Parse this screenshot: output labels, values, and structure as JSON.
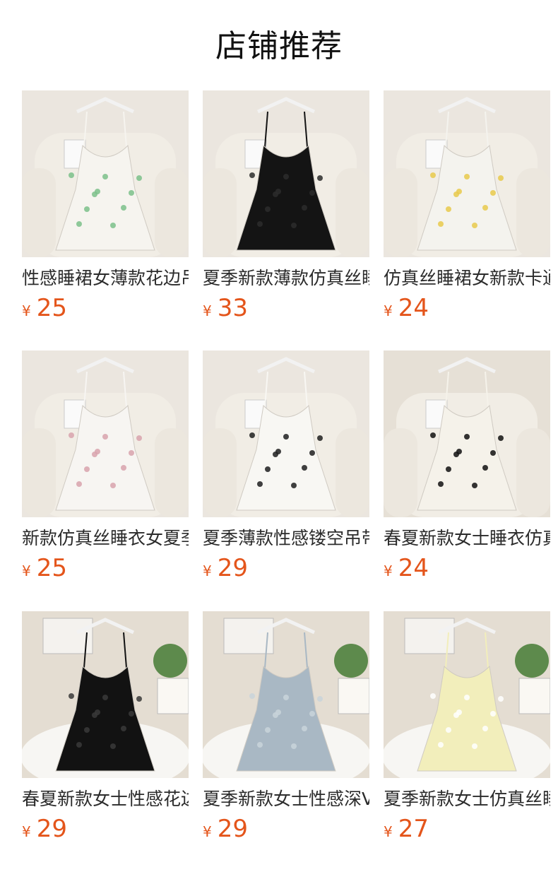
{
  "header": {
    "title": "店铺推荐"
  },
  "products": [
    {
      "name": "性感睡裙女薄款花边吊带",
      "currency": "¥",
      "price": "25",
      "image": "white floral slip dress on chair",
      "bg": "#ebe6df",
      "dress": "#f6f4ef",
      "accent": "#7bbf8a"
    },
    {
      "name": "夏季新款薄款仿真丝睡裙",
      "currency": "¥",
      "price": "33",
      "image": "black lace slip dress on chair",
      "bg": "#ebe6df",
      "dress": "#141414",
      "accent": "#2c2c2c"
    },
    {
      "name": "仿真丝睡裙女新款卡通吊带",
      "currency": "¥",
      "price": "24",
      "image": "white printed slip dress on chair",
      "bg": "#ebe6df",
      "dress": "#f4f3ee",
      "accent": "#e7c94b"
    },
    {
      "name": "新款仿真丝睡衣女夏季吊带",
      "currency": "¥",
      "price": "25",
      "image": "white slip dress with pink pattern",
      "bg": "#ebe6df",
      "dress": "#f7f5f2",
      "accent": "#d8a2ad"
    },
    {
      "name": "夏季薄款性感镂空吊带睡裙",
      "currency": "¥",
      "price": "29",
      "image": "white cherry print slip dress",
      "bg": "#ebe6df",
      "dress": "#f8f7f3",
      "accent": "#1e1e1e"
    },
    {
      "name": "春夏新款女士睡衣仿真丝",
      "currency": "¥",
      "price": "24",
      "image": "white heart print slip dress",
      "bg": "#e6e0d6",
      "dress": "#f5f2ea",
      "accent": "#111111"
    },
    {
      "name": "春夏新款女士性感花边睡裙",
      "currency": "¥",
      "price": "29",
      "image": "black lace slip dress on fur",
      "bg": "#e4ddd2",
      "dress": "#121212",
      "accent": "#3a3a3a"
    },
    {
      "name": "夏季新款女士性感深V睡裙",
      "currency": "¥",
      "price": "29",
      "image": "light blue lace slip dress on fur",
      "bg": "#e4ddd2",
      "dress": "#a9b8c4",
      "accent": "#c9d3db"
    },
    {
      "name": "夏季新款女士仿真丝睡裙",
      "currency": "¥",
      "price": "27",
      "image": "pale yellow lace slip dress on fur",
      "bg": "#e4ddd2",
      "dress": "#f2eebb",
      "accent": "#ffffff"
    }
  ]
}
